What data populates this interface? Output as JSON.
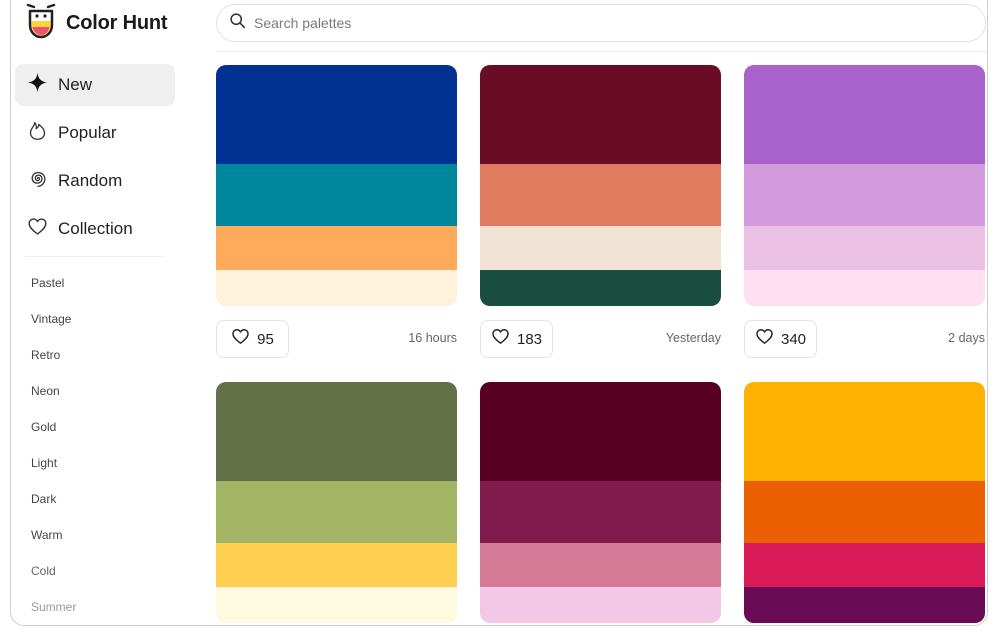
{
  "app": {
    "title": "Color Hunt"
  },
  "search": {
    "placeholder": "Search palettes"
  },
  "nav": [
    {
      "label": "New",
      "icon": "sparkle-icon",
      "active": true
    },
    {
      "label": "Popular",
      "icon": "flame-icon"
    },
    {
      "label": "Random",
      "icon": "spiral-icon"
    },
    {
      "label": "Collection",
      "icon": "heart-icon"
    }
  ],
  "tags": [
    "Pastel",
    "Vintage",
    "Retro",
    "Neon",
    "Gold",
    "Light",
    "Dark",
    "Warm",
    "Cold",
    "Summer"
  ],
  "palettes": [
    {
      "colors": [
        "#003092",
        "#00879E",
        "#FFAB5B",
        "#FFF2DB"
      ],
      "likes": "95",
      "time": "16 hours"
    },
    {
      "colors": [
        "#6A0C25",
        "#E07B5F",
        "#F0E3D5",
        "#194D3D"
      ],
      "likes": "183",
      "time": "Yesterday"
    },
    {
      "colors": [
        "#A962CC",
        "#D49ADE",
        "#EBC1E5",
        "#FFDFF0"
      ],
      "likes": "340",
      "time": "2 days"
    },
    {
      "colors": [
        "#626F47",
        "#A4B465",
        "#FFCF50",
        "#FEFAE0"
      ],
      "likes": "",
      "time": ""
    },
    {
      "colors": [
        "#580020",
        "#801B4C",
        "#D47A96",
        "#F3C8E7"
      ],
      "likes": "",
      "time": ""
    },
    {
      "colors": [
        "#FFB100",
        "#EA5F00",
        "#DB1A59",
        "#690B55"
      ],
      "likes": "",
      "time": ""
    }
  ]
}
